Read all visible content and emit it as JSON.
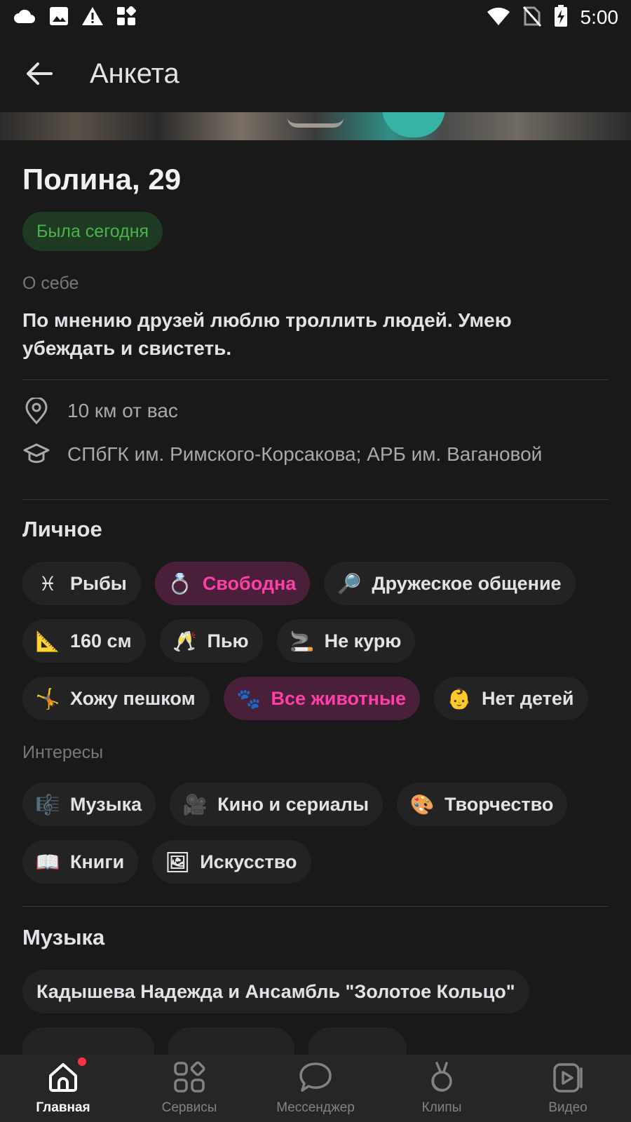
{
  "status_bar": {
    "time": "5:00",
    "left_icons": [
      "cloud-icon",
      "image-icon",
      "warning-icon",
      "apps-icon"
    ],
    "right_icons": [
      "wifi-icon",
      "no-sim-icon",
      "battery-charging-icon"
    ]
  },
  "app_bar": {
    "title": "Анкета"
  },
  "profile": {
    "name": "Полина, 29",
    "status_badge": "Была сегодня",
    "about_label": "О себе",
    "about_text": "По мнению друзей люблю троллить людей. Умею убеждать и свистеть.",
    "distance": "10 км от вас",
    "education": "СПбГК им. Римского-Корсакова; АРБ им. Вагановой"
  },
  "personal": {
    "title": "Личное",
    "chips": [
      {
        "icon": "♓",
        "label": "Рыбы",
        "highlight": false
      },
      {
        "icon": "💍",
        "label": "Свободна",
        "highlight": true
      },
      {
        "icon": "🔎",
        "label": "Дружеское общение",
        "highlight": false
      },
      {
        "icon": "📐",
        "label": "160 см",
        "highlight": false
      },
      {
        "icon": "🥂",
        "label": "Пью",
        "highlight": false
      },
      {
        "icon": "🚬",
        "label": "Не курю",
        "highlight": false
      },
      {
        "icon": "🤸",
        "label": "Хожу пешком",
        "highlight": false
      },
      {
        "icon": "🐾",
        "label": "Все животные",
        "highlight": true
      },
      {
        "icon": "👶",
        "label": "Нет детей",
        "highlight": false
      }
    ]
  },
  "interests": {
    "label": "Интересы",
    "chips": [
      {
        "icon": "🎼",
        "label": "Музыка"
      },
      {
        "icon": "🎥",
        "label": "Кино и сериалы"
      },
      {
        "icon": "🎨",
        "label": "Творчество"
      },
      {
        "icon": "📖",
        "label": "Книги"
      },
      {
        "icon": "🖼",
        "label": "Искусство"
      }
    ]
  },
  "music": {
    "title": "Музыка",
    "chips": [
      "Кадышева Надежда и Ансамбль \"Золотое Кольцо\""
    ]
  },
  "bottom_nav": [
    {
      "label": "Главная",
      "icon": "home-icon",
      "active": true
    },
    {
      "label": "Сервисы",
      "icon": "services-icon",
      "active": false
    },
    {
      "label": "Мессенджер",
      "icon": "messenger-icon",
      "active": false
    },
    {
      "label": "Клипы",
      "icon": "clips-icon",
      "active": false
    },
    {
      "label": "Видео",
      "icon": "video-icon",
      "active": false
    }
  ],
  "colors": {
    "background": "#19191a",
    "online_green": "#4bb34b",
    "highlight_pink": "#ff3fa8",
    "notification_red": "#ff3347"
  }
}
